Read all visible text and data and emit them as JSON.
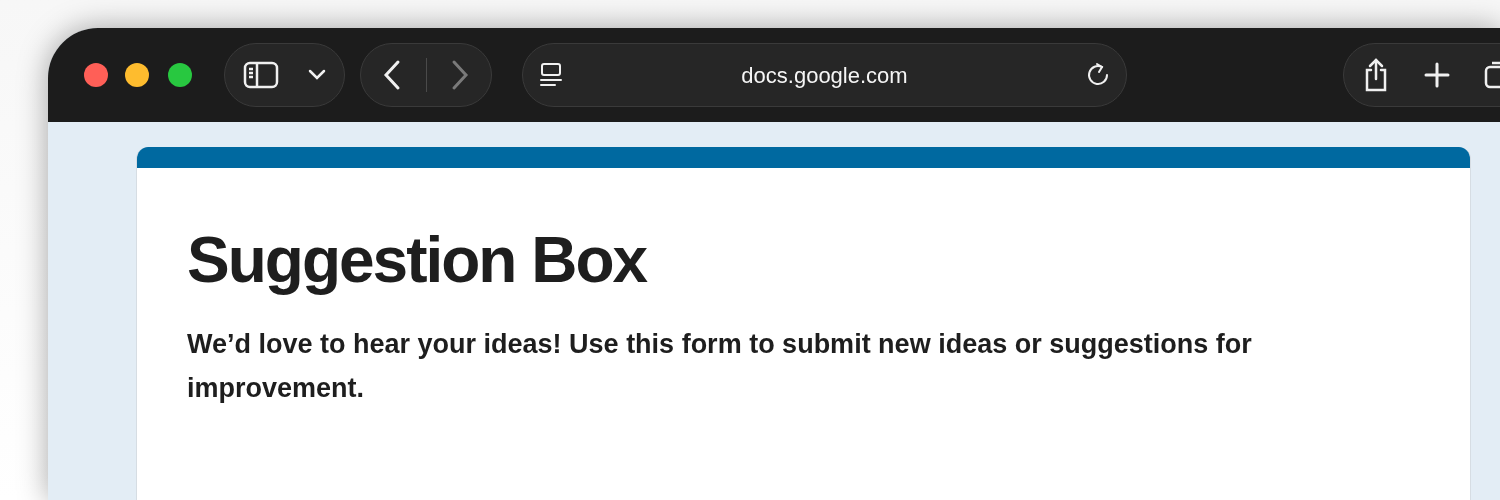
{
  "browser": {
    "url": "docs.google.com",
    "back_disabled": false,
    "forward_disabled": true
  },
  "form": {
    "title": "Suggestion Box",
    "description": "We’d love to hear your ideas! Use this form to submit new ideas or suggestions for improvement."
  }
}
